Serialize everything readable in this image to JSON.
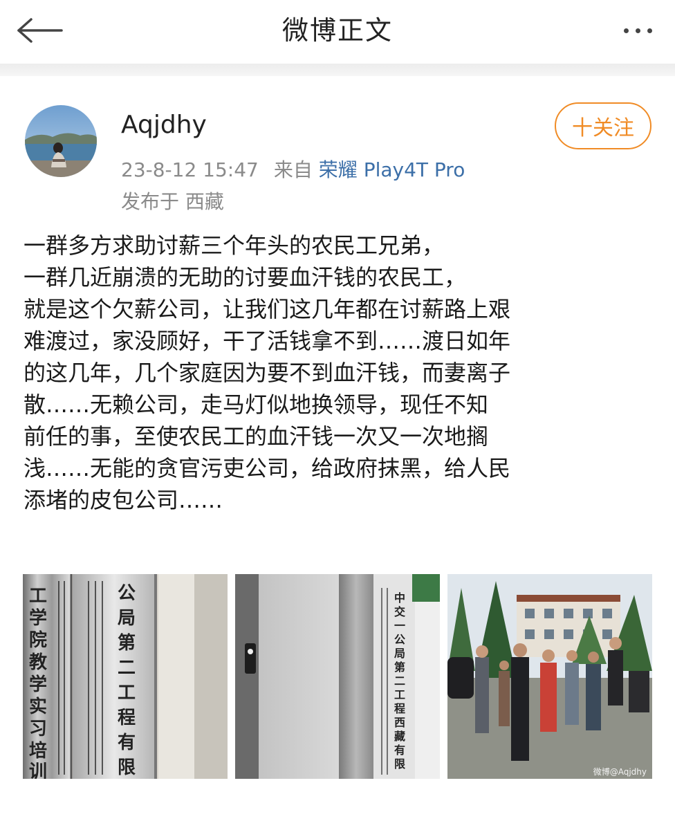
{
  "nav": {
    "title": "微博正文",
    "back_icon": "back-arrow-icon",
    "more_icon": "more-dots-icon"
  },
  "author": {
    "username": "Aqjdhy",
    "timestamp": "23-8-12 15:47",
    "source_prefix": "来自",
    "device": "荣耀 Play4T Pro",
    "location": "发布于 西藏",
    "follow_label": "十关注",
    "follow_color": "#f08b25",
    "device_color": "#3c6fa8"
  },
  "post": {
    "lines": [
      "一群多方求助讨薪三个年头的农民工兄弟，",
      "一群几近崩溃的无助的讨要血汗钱的农民工，",
      "就是这个欠薪公司，让我们这几年都在讨薪路上艰",
      "难渡过，家没顾好，干了活钱拿不到……渡日如年",
      "的这几年，几个家庭因为要不到血汗钱，而妻离子",
      "散……无赖公司，走马灯似地换领导，现任不知",
      "前任的事，至使农民工的血汗钱一次又一次地搁",
      "浅……无能的贪官污吏公司，给政府抹黑，给人民",
      "添堵的皮包公司……"
    ]
  },
  "images": [
    {
      "sign_left": "工学院教学实习培训基",
      "sign_right": "公局第二工程有限公司拉萨"
    },
    {
      "sign_text": "中交一公局第二工程西藏有限公司"
    },
    {
      "watermark": "微博@Aqjdhy"
    }
  ]
}
